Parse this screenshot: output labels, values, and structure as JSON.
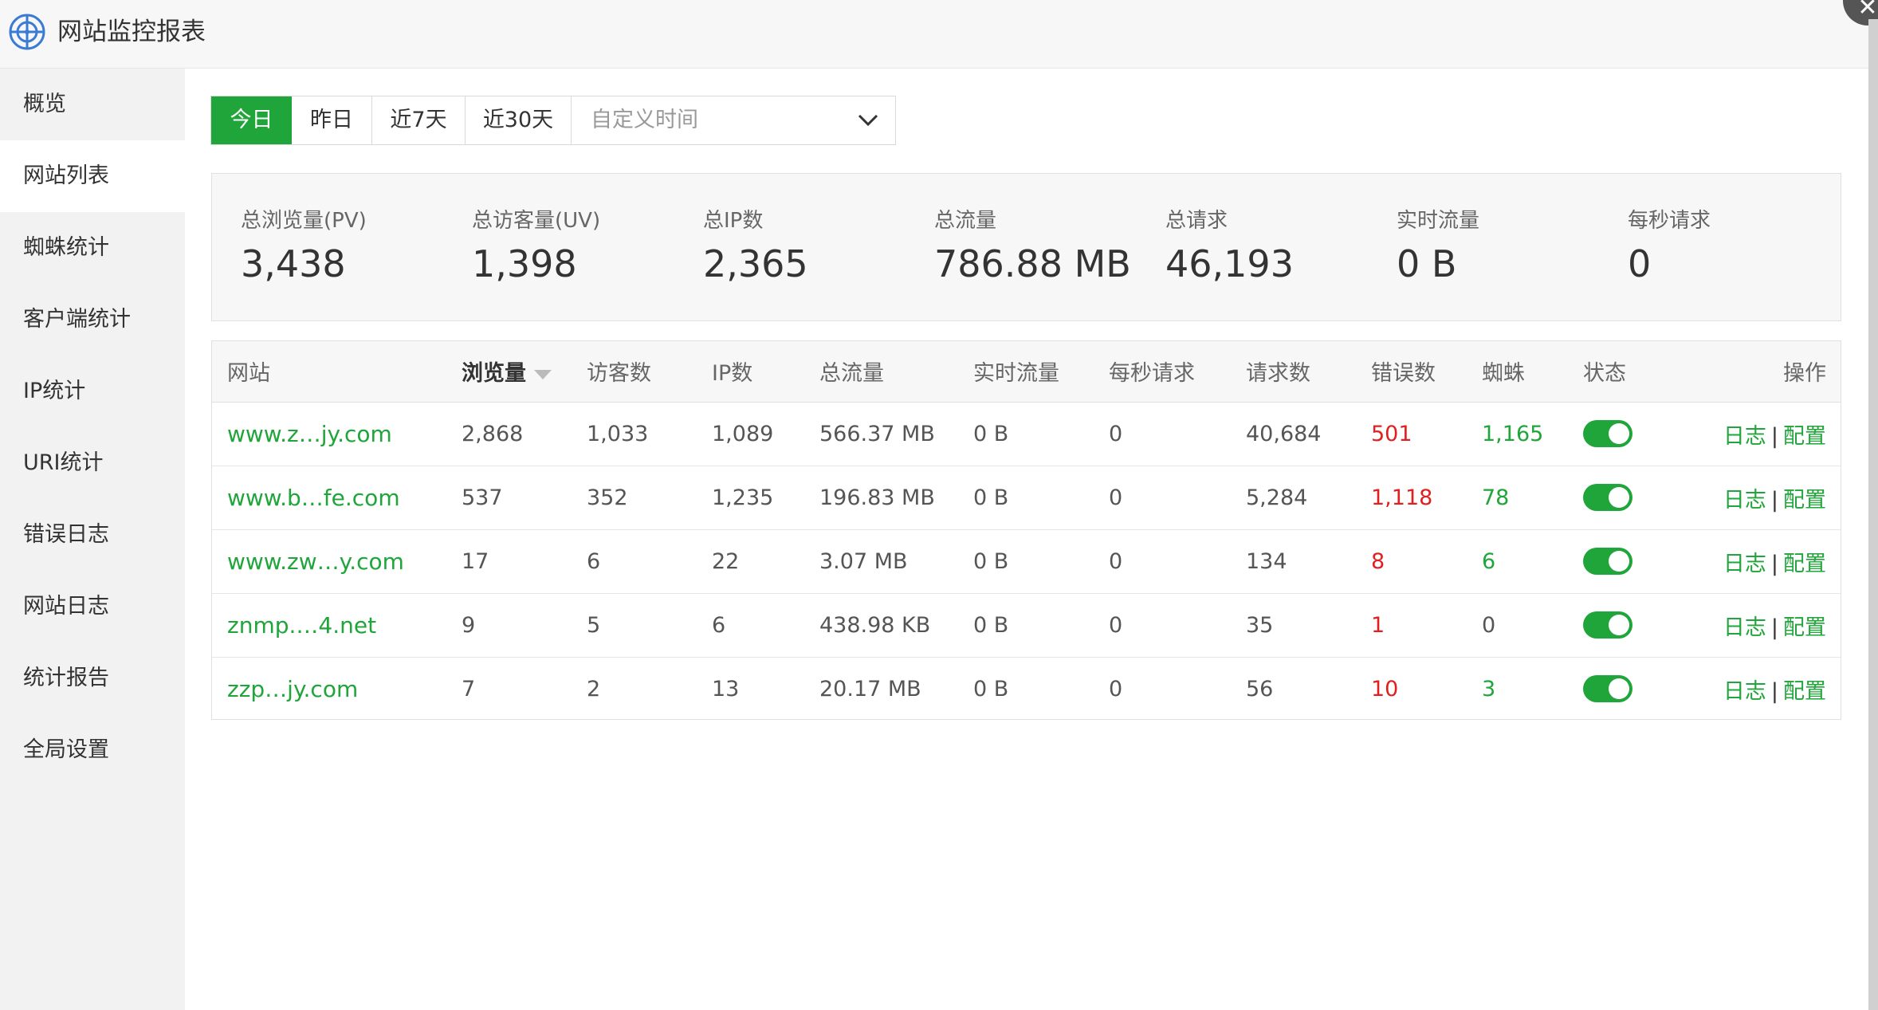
{
  "app": {
    "title": "网站监控报表",
    "close_icon": "close-icon",
    "accent": "#20a53a"
  },
  "sidebar": {
    "items": [
      {
        "label": "概览"
      },
      {
        "label": "网站列表",
        "active": true
      },
      {
        "label": "蜘蛛统计"
      },
      {
        "label": "客户端统计"
      },
      {
        "label": "IP统计"
      },
      {
        "label": "URI统计"
      },
      {
        "label": "错误日志"
      },
      {
        "label": "网站日志"
      },
      {
        "label": "统计报告"
      },
      {
        "label": "全局设置"
      }
    ]
  },
  "filters": {
    "tabs": [
      {
        "label": "今日",
        "active": true
      },
      {
        "label": "昨日"
      },
      {
        "label": "近7天"
      },
      {
        "label": "近30天"
      }
    ],
    "custom_placeholder": "自定义时间"
  },
  "stats": [
    {
      "label": "总浏览量(PV)",
      "value": "3,438"
    },
    {
      "label": "总访客量(UV)",
      "value": "1,398"
    },
    {
      "label": "总IP数",
      "value": "2,365"
    },
    {
      "label": "总流量",
      "value": "786.88 MB"
    },
    {
      "label": "总请求",
      "value": "46,193"
    },
    {
      "label": "实时流量",
      "value": "0 B"
    },
    {
      "label": "每秒请求",
      "value": "0"
    }
  ],
  "table": {
    "headers": {
      "site": "网站",
      "pv": "浏览量",
      "uv": "访客数",
      "ip": "IP数",
      "traffic": "总流量",
      "realtime": "实时流量",
      "rps": "每秒请求",
      "requests": "请求数",
      "errors": "错误数",
      "spider": "蜘蛛",
      "status": "状态",
      "ops": "操作"
    },
    "op_log": "日志",
    "op_sep": "|",
    "op_config": "配置",
    "rows": [
      {
        "site": "www.z…jy.com",
        "pv": "2,868",
        "uv": "1,033",
        "ip": "1,089",
        "traffic": "566.37 MB",
        "realtime": "0 B",
        "rps": "0",
        "requests": "40,684",
        "errors": "501",
        "spider": "1,165",
        "enabled": true
      },
      {
        "site": "www.b…fe.com",
        "pv": "537",
        "uv": "352",
        "ip": "1,235",
        "traffic": "196.83 MB",
        "realtime": "0 B",
        "rps": "0",
        "requests": "5,284",
        "errors": "1,118",
        "spider": "78",
        "enabled": true
      },
      {
        "site": "www.zw…y.com",
        "pv": "17",
        "uv": "6",
        "ip": "22",
        "traffic": "3.07 MB",
        "realtime": "0 B",
        "rps": "0",
        "requests": "134",
        "errors": "8",
        "spider": "6",
        "enabled": true
      },
      {
        "site": "znmp.…4.net",
        "pv": "9",
        "uv": "5",
        "ip": "6",
        "traffic": "438.98 KB",
        "realtime": "0 B",
        "rps": "0",
        "requests": "35",
        "errors": "1",
        "spider": "0",
        "enabled": true
      },
      {
        "site": "zzp…jy.com",
        "pv": "7",
        "uv": "2",
        "ip": "13",
        "traffic": "20.17 MB",
        "realtime": "0 B",
        "rps": "0",
        "requests": "56",
        "errors": "10",
        "spider": "3",
        "enabled": true
      }
    ]
  }
}
